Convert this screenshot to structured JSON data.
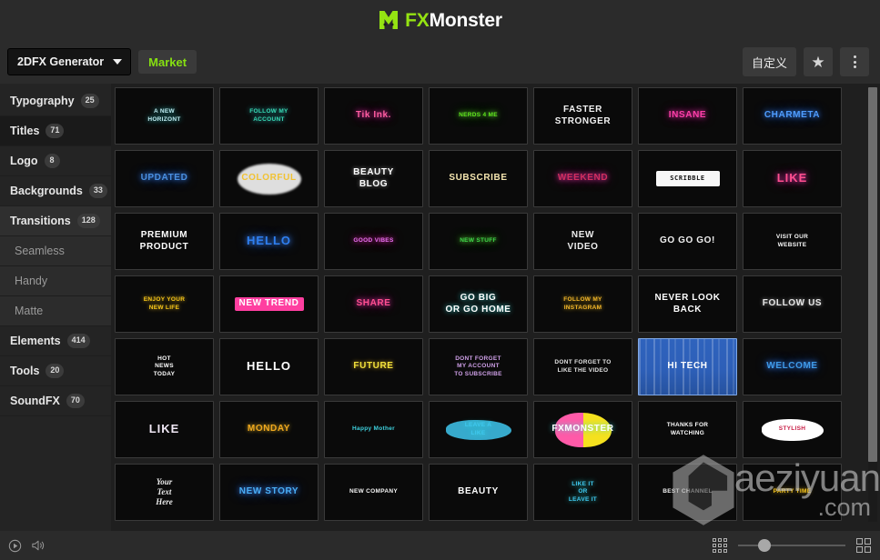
{
  "header": {
    "brand_fx": "FX",
    "brand_monster": "Monster",
    "logo_icon": "monster-m-logo",
    "logo_color": "#95e312"
  },
  "toolbar": {
    "generator_label": "2DFX Generator",
    "caret_icon": "chevron-down-icon",
    "market_label": "Market",
    "market_color": "#86e011",
    "customize_label": "自定义",
    "star_icon": "star-icon",
    "menu_icon": "kebab-menu-icon"
  },
  "sidebar": {
    "items": [
      {
        "label": "Typography",
        "badge": "25",
        "sub": false,
        "state": ""
      },
      {
        "label": "Titles",
        "badge": "71",
        "sub": false,
        "state": "active"
      },
      {
        "label": "Logo",
        "badge": "8",
        "sub": false,
        "state": ""
      },
      {
        "label": "Backgrounds",
        "badge": "33",
        "sub": false,
        "state": ""
      },
      {
        "label": "Transitions",
        "badge": "128",
        "sub": false,
        "state": "hl"
      },
      {
        "label": "Seamless",
        "badge": "",
        "sub": true,
        "state": ""
      },
      {
        "label": "Handy",
        "badge": "",
        "sub": true,
        "state": ""
      },
      {
        "label": "Matte",
        "badge": "",
        "sub": true,
        "state": ""
      },
      {
        "label": "Elements",
        "badge": "414",
        "sub": false,
        "state": ""
      },
      {
        "label": "Tools",
        "badge": "20",
        "sub": false,
        "state": ""
      },
      {
        "label": "SoundFX",
        "badge": "70",
        "sub": false,
        "state": ""
      }
    ]
  },
  "grid": {
    "items": [
      {
        "text": "A NEW\nHORIZONT",
        "style": "st-tiny glow-c",
        "color": "#bfe9ef"
      },
      {
        "text": "FOLLOW MY\nACCOUNT",
        "style": "st-tiny glow-c",
        "color": "#37d9b4"
      },
      {
        "text": "Tik Ink.",
        "style": "st-mid glow-p",
        "color": "#ff5ea0"
      },
      {
        "text": "NERDS 4 ME",
        "style": "st-tiny glow-g",
        "color": "#61e81c"
      },
      {
        "text": "FASTER\nSTRONGER",
        "style": "st-mid",
        "color": "#f2f2f2"
      },
      {
        "text": "INSANE",
        "style": "st-mid glow-p",
        "color": "#ff3fa8"
      },
      {
        "text": "CHARMETA",
        "style": "st-mid glow-b",
        "color": "#4f9dff"
      },
      {
        "text": "UPDATED",
        "style": "st-mid glow-b",
        "color": "#4a8fe0"
      },
      {
        "text": "COLORFUL",
        "style": "st-mid",
        "color": "#f1c232"
      },
      {
        "text": "BEAUTY\nBLOG",
        "style": "st-mid glow-w",
        "color": "#ffffff"
      },
      {
        "text": "SUBSCRIBE",
        "style": "st-mid",
        "color": "#f6e7b0"
      },
      {
        "text": "WEEKEND",
        "style": "st-mid glow-p",
        "color": "#d12e5f"
      },
      {
        "text": "SCRIBBLE",
        "style": "st-mono",
        "color": "#101010"
      },
      {
        "text": "LIKE",
        "style": "st-big glow-p",
        "color": "#ff4f8f"
      },
      {
        "text": "PREMIUM\nPRODUCT",
        "style": "st-mid",
        "color": "#ffffff"
      },
      {
        "text": "HELLO",
        "style": "st-big glow-b",
        "color": "#2f7ff0"
      },
      {
        "text": "GOOD VIBES",
        "style": "st-tiny glow-p",
        "color": "#e66ff0"
      },
      {
        "text": "NEW STUFF",
        "style": "st-tiny glow-g",
        "color": "#3fd94a"
      },
      {
        "text": "NEW\nVIDEO",
        "style": "st-mid",
        "color": "#ededed"
      },
      {
        "text": "GO GO GO!",
        "style": "st-mid",
        "color": "#f0f0f0"
      },
      {
        "text": "VISIT OUR\nWEBSITE",
        "style": "st-tiny",
        "color": "#fafafa"
      },
      {
        "text": "ENJOY YOUR\nNEW LIFE",
        "style": "st-tiny glow-y",
        "color": "#f5c518"
      },
      {
        "text": "NEW TREND",
        "style": "st-mid",
        "color": "#ffffff"
      },
      {
        "text": "SHARE",
        "style": "st-mid glow-p",
        "color": "#ff4f8f"
      },
      {
        "text": "GO BIG\nOR GO HOME",
        "style": "st-mid glow-c",
        "color": "#ffffff"
      },
      {
        "text": "FOLLOW MY\nINSTAGRAM",
        "style": "st-tiny glow-y",
        "color": "#f0b429"
      },
      {
        "text": "NEVER LOOK\nBACK",
        "style": "st-mid",
        "color": "#ffffff"
      },
      {
        "text": "FOLLOW US",
        "style": "st-mid glow-w",
        "color": "#e8e8e8"
      },
      {
        "text": "HOT\nNEWS\nTODAY",
        "style": "st-tiny",
        "color": "#ffffff"
      },
      {
        "text": "HELLO",
        "style": "st-big",
        "color": "#ffffff"
      },
      {
        "text": "FUTURE",
        "style": "st-mid glow-y",
        "color": "#f2e23c"
      },
      {
        "text": "DONT FORGET\nMY ACCOUNT\nTO SUBSCRIBE",
        "style": "st-tiny",
        "color": "#cfa0e8"
      },
      {
        "text": "DONT FORGET TO\nLIKE THE VIDEO",
        "style": "st-tiny",
        "color": "#e2e2e2"
      },
      {
        "text": "HI TECH",
        "style": "st-mid",
        "color": "#ffffff"
      },
      {
        "text": "WELCOME",
        "style": "st-mid glow-b",
        "color": "#3f9ae8"
      },
      {
        "text": "LIKE",
        "style": "st-big",
        "color": "#f0e8f5"
      },
      {
        "text": "MONDAY",
        "style": "st-mid glow-y",
        "color": "#f0a81e"
      },
      {
        "text": "Happy Mother",
        "style": "st-tiny",
        "color": "#3fd3e0"
      },
      {
        "text": "LEAVE A\nLIKE",
        "style": "st-tiny glow-c",
        "color": "#3fc7ef"
      },
      {
        "text": "FXMONSTER",
        "style": "st-mid glow-c",
        "color": "#ffffff"
      },
      {
        "text": "THANKS FOR\nWATCHING",
        "style": "st-tiny",
        "color": "#ffffff"
      },
      {
        "text": "STYLISH",
        "style": "st-tiny",
        "color": "#c81e46"
      },
      {
        "text": "Your\nText\nHere",
        "style": "st-script",
        "color": "#ededed"
      },
      {
        "text": "NEW STORY",
        "style": "st-mid glow-b",
        "color": "#4aaef5"
      },
      {
        "text": "NEW COMPANY",
        "style": "st-tiny",
        "color": "#f5f5f5"
      },
      {
        "text": "BEAUTY",
        "style": "st-mid",
        "color": "#ffffff"
      },
      {
        "text": "LIKE IT\nOR\nLEAVE IT",
        "style": "st-tiny glow-c",
        "color": "#3fc7ef"
      },
      {
        "text": "BEST CHANNEL",
        "style": "st-tiny",
        "color": "#f0f0f0"
      },
      {
        "text": "PARTY TIME",
        "style": "st-tiny glow-y",
        "color": "#f2c21e"
      }
    ],
    "selected_index": 33
  },
  "watermark": {
    "main": "aeziyuan",
    "sub": ".com",
    "cube_icon": "hex-cube-logo"
  },
  "bottombar": {
    "play_icon": "play-circle-icon",
    "volume_icon": "volume-icon",
    "small-grid_icon": "grid-small-icon",
    "large-grid_icon": "grid-large-icon",
    "zoom_value": "18"
  }
}
